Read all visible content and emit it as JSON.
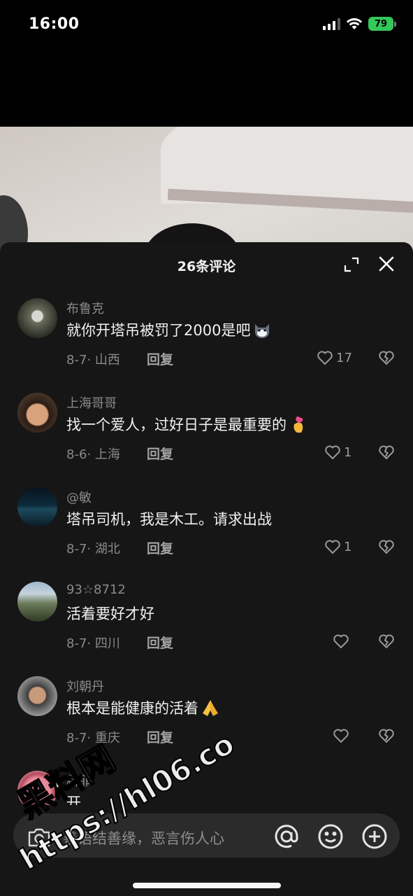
{
  "status_bar": {
    "time": "16:00",
    "battery": "79"
  },
  "sheet": {
    "title": "26条评论"
  },
  "comments": [
    {
      "user": "布鲁克",
      "text": "就你开塔吊被罚了2000是吧",
      "emoji": "cat-emoji",
      "date": "8-7",
      "location": "山西",
      "reply": "回复",
      "likes": "17"
    },
    {
      "user": "上海哥哥",
      "text": "找一个爱人，过好日子是最重要的",
      "emoji": "finger-heart-emoji",
      "date": "8-6",
      "location": "上海",
      "reply": "回复",
      "likes": "1"
    },
    {
      "user": "@敏",
      "text": "塔吊司机，我是木工。请求出战",
      "emoji": "",
      "date": "8-7",
      "location": "湖北",
      "reply": "回复",
      "likes": "1"
    },
    {
      "user": "93☆8712",
      "text": "活着要好才好",
      "emoji": "",
      "date": "8-7",
      "location": "四川",
      "reply": "回复",
      "likes": ""
    },
    {
      "user": "刘朝丹",
      "text": "根本是能健康的活着",
      "emoji": "praying-hands-emoji",
      "date": "8-7",
      "location": "重庆",
      "reply": "回复",
      "likes": ""
    },
    {
      "user": "科菲",
      "text": "开",
      "emoji": "",
      "date": "",
      "location": "",
      "reply": "",
      "likes": ""
    }
  ],
  "input": {
    "placeholder": "善语结善缘，恶言伤人心"
  },
  "watermark": {
    "line1": "黑料网",
    "line2": "https://hl06.co"
  },
  "icons": {
    "expand": "expand-icon",
    "close": "close-icon",
    "like": "heart-icon",
    "dislike": "broken-heart-icon",
    "camera": "camera-icon",
    "mention": "at-icon",
    "emoji": "smiley-icon",
    "add": "plus-icon"
  },
  "colors": {
    "sheet_bg": "#161616",
    "muted_text": "#8a8a8a",
    "battery": "#34c759"
  }
}
